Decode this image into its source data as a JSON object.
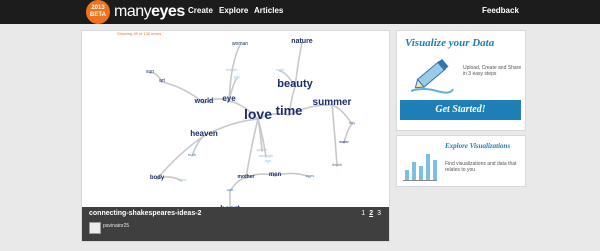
{
  "header": {
    "badge_year": "2013",
    "badge_label": "BETA",
    "logo_light": "many",
    "logo_bold": "eyes",
    "nav": [
      "Create",
      "Explore",
      "Articles"
    ],
    "feedback": "Feedback"
  },
  "visualization": {
    "showing_text": "Showing 45 of 130 terms",
    "title": "connecting-shakespeares-ideas-2",
    "author": "pavinator25",
    "pages": [
      "1",
      "2",
      "3"
    ],
    "current_page": "2",
    "colors": {
      "primary": "#1b2e6b",
      "secondary": "#4a7bb7",
      "light": "#9cc7e6",
      "edge": "#c8c8c8"
    },
    "words": [
      {
        "text": "love",
        "tone": "primary"
      },
      {
        "text": "time",
        "tone": "primary"
      },
      {
        "text": "beauty",
        "tone": "primary"
      },
      {
        "text": "summer",
        "tone": "primary"
      },
      {
        "text": "heaven",
        "tone": "primary"
      },
      {
        "text": "nature",
        "tone": "primary"
      },
      {
        "text": "world",
        "tone": "primary"
      },
      {
        "text": "eye",
        "tone": "primary"
      },
      {
        "text": "heart",
        "tone": "primary"
      },
      {
        "text": "body",
        "tone": "primary"
      },
      {
        "text": "mother",
        "tone": "primary"
      },
      {
        "text": "men",
        "tone": "primary"
      },
      {
        "text": "woman",
        "tone": "primary"
      },
      {
        "text": "water",
        "tone": "primary"
      },
      {
        "text": "art",
        "tone": "primary"
      },
      {
        "text": "sun",
        "tone": "primary"
      },
      {
        "text": "day",
        "tone": "secondary"
      },
      {
        "text": "eyes",
        "tone": "secondary"
      },
      {
        "text": "truth",
        "tone": "secondary"
      },
      {
        "text": "war",
        "tone": "secondary"
      },
      {
        "text": "death",
        "tone": "secondary"
      },
      {
        "text": "gentle",
        "tone": "light"
      },
      {
        "text": "breath",
        "tone": "light"
      },
      {
        "text": "strength",
        "tone": "light"
      },
      {
        "text": "night",
        "tone": "light"
      },
      {
        "text": "age",
        "tone": "light"
      },
      {
        "text": "mind",
        "tone": "light"
      },
      {
        "text": "pity",
        "tone": "light"
      }
    ]
  },
  "promo": {
    "visualize_title": "Visualize your Data",
    "visualize_desc": "Upload, Create and Share in 3 easy steps",
    "cta": "Get Started!",
    "explore_title": "Explore Visualizations",
    "explore_desc": "Find visualizations and data that relates to you",
    "icon_pencil": "pencil-icon",
    "icon_bars": "bar-chart-icon"
  }
}
